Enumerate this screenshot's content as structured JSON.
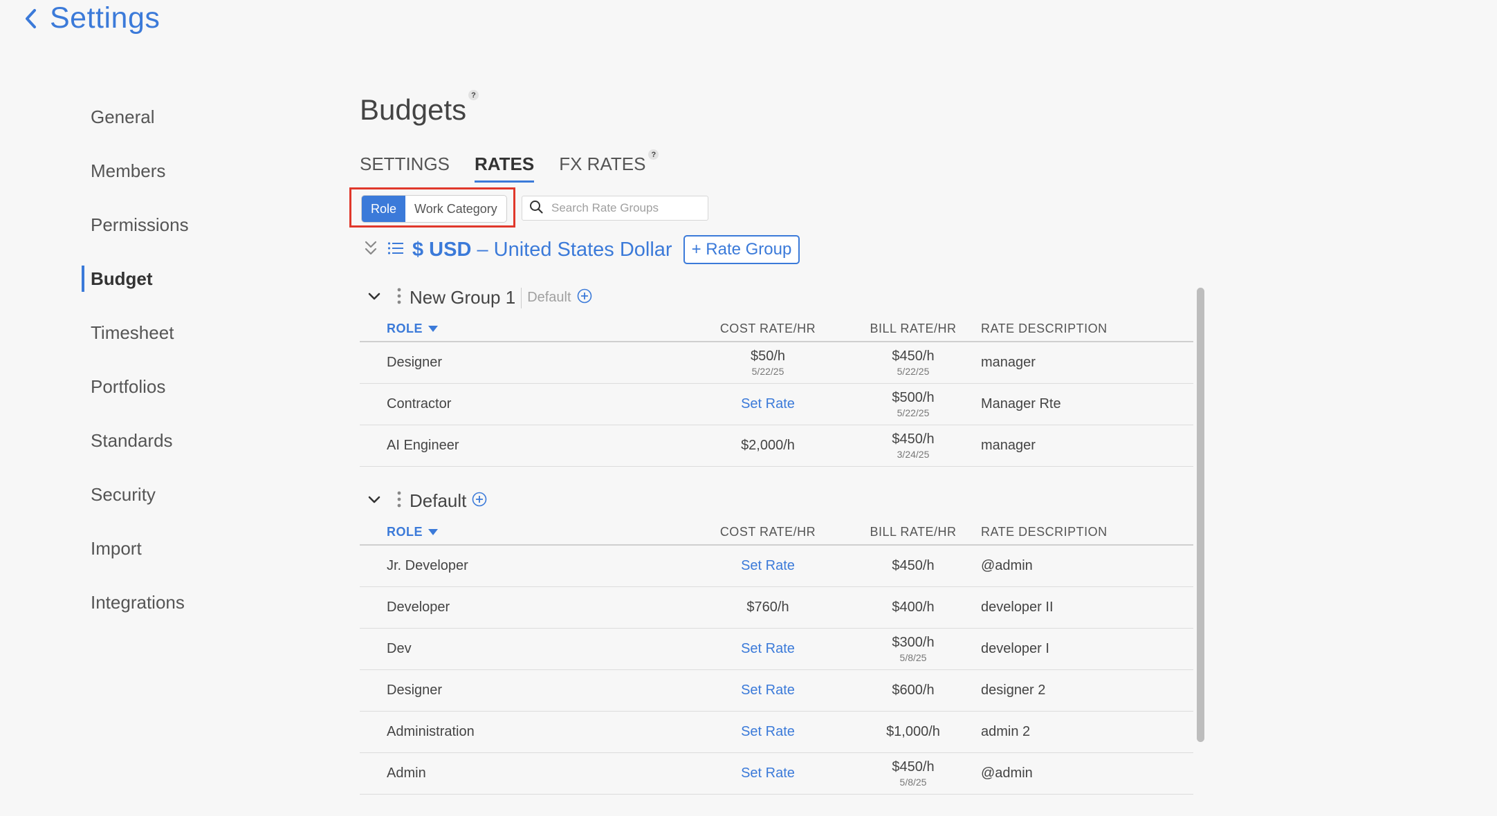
{
  "header": {
    "title": "Settings"
  },
  "sidebar": {
    "items": [
      {
        "label": "General"
      },
      {
        "label": "Members"
      },
      {
        "label": "Permissions"
      },
      {
        "label": "Budget"
      },
      {
        "label": "Timesheet"
      },
      {
        "label": "Portfolios"
      },
      {
        "label": "Standards"
      },
      {
        "label": "Security"
      },
      {
        "label": "Import"
      },
      {
        "label": "Integrations"
      }
    ],
    "active": "Budget"
  },
  "main": {
    "title": "Budgets",
    "help": "?",
    "tabs": [
      {
        "label": "SETTINGS"
      },
      {
        "label": "RATES"
      },
      {
        "label": "FX RATES"
      }
    ],
    "active_tab": "RATES",
    "toggle": {
      "role": "Role",
      "work_category": "Work Category",
      "selected": "Role"
    },
    "search": {
      "placeholder": "Search Rate Groups",
      "value": ""
    },
    "currency": {
      "symbol_code": "$ USD",
      "name": "– United States Dollar"
    },
    "add_rate_group": "+ Rate Group",
    "accent_color": "#3b7ad9",
    "highlight_color": "#e0382b"
  },
  "columns": {
    "role": "ROLE",
    "cost": "COST RATE/HR",
    "bill": "BILL RATE/HR",
    "desc": "RATE DESCRIPTION"
  },
  "groups": [
    {
      "name": "New Group 1",
      "default_label": "Default",
      "rows": [
        {
          "role": "Designer",
          "cost": "$50/h",
          "cost_date": "5/22/25",
          "bill": "$450/h",
          "bill_date": "5/22/25",
          "desc": "manager"
        },
        {
          "role": "Contractor",
          "cost": "Set Rate",
          "cost_date": "",
          "bill": "$500/h",
          "bill_date": "5/22/25",
          "desc": "Manager Rte"
        },
        {
          "role": "AI Engineer",
          "cost": "$2,000/h",
          "cost_date": "",
          "bill": "$450/h",
          "bill_date": "3/24/25",
          "desc": "manager"
        }
      ]
    },
    {
      "name": "Default",
      "default_label": "",
      "rows": [
        {
          "role": "Jr. Developer",
          "cost": "Set Rate",
          "cost_date": "",
          "bill": "$450/h",
          "bill_date": "",
          "desc": "@admin"
        },
        {
          "role": "Developer",
          "cost": "$760/h",
          "cost_date": "",
          "bill": "$400/h",
          "bill_date": "",
          "desc": "developer II"
        },
        {
          "role": "Dev",
          "cost": "Set Rate",
          "cost_date": "",
          "bill": "$300/h",
          "bill_date": "5/8/25",
          "desc": "developer I"
        },
        {
          "role": "Designer",
          "cost": "Set Rate",
          "cost_date": "",
          "bill": "$600/h",
          "bill_date": "",
          "desc": "designer 2"
        },
        {
          "role": "Administration",
          "cost": "Set Rate",
          "cost_date": "",
          "bill": "$1,000/h",
          "bill_date": "",
          "desc": "admin 2"
        },
        {
          "role": "Admin",
          "cost": "Set Rate",
          "cost_date": "",
          "bill": "$450/h",
          "bill_date": "5/8/25",
          "desc": "@admin"
        }
      ]
    }
  ]
}
